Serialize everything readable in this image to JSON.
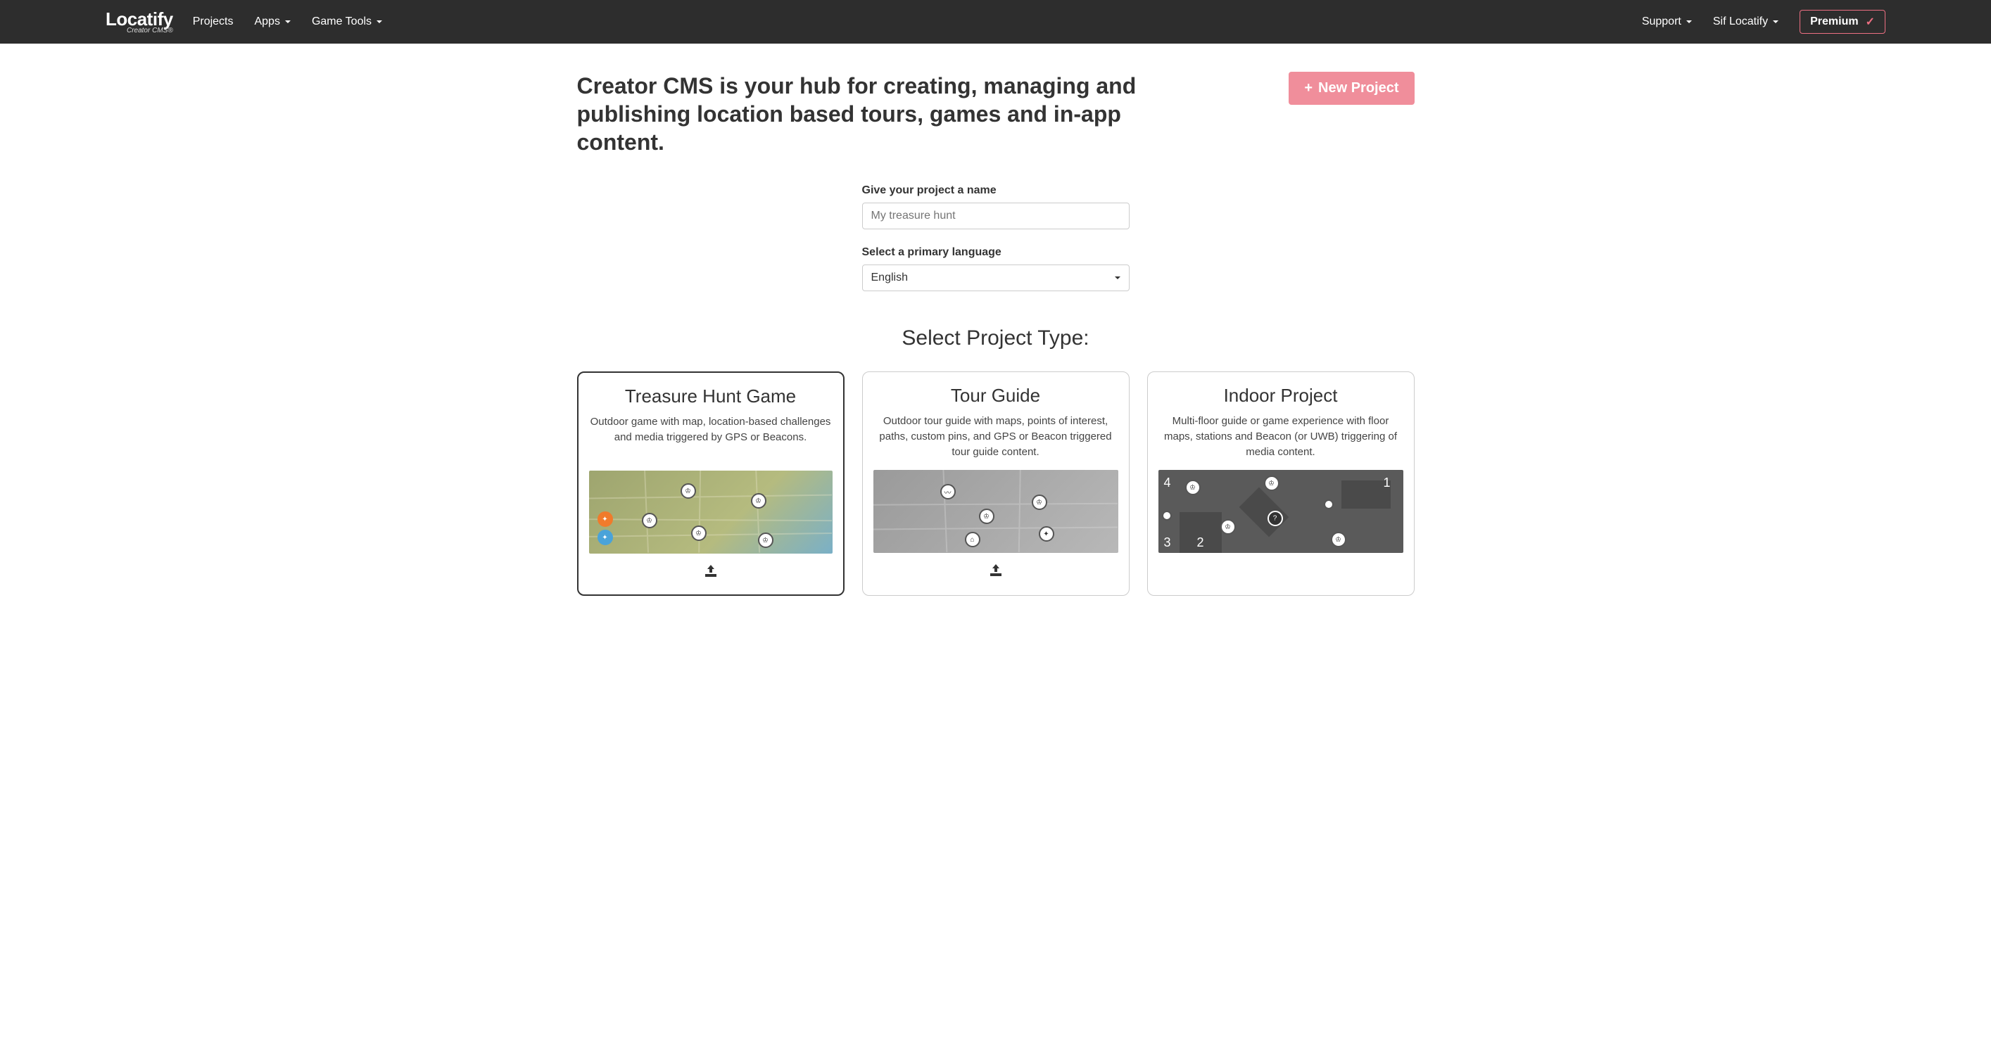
{
  "nav": {
    "brand": "Locatify",
    "brand_sub": "Creator CMS®",
    "items": [
      "Projects",
      "Apps",
      "Game Tools"
    ],
    "support": "Support",
    "user": "Sif Locatify",
    "premium": "Premium"
  },
  "hero": {
    "title": "Creator CMS is your hub for creating, managing and publishing location based tours, games and in-app content.",
    "new_project": "New Project"
  },
  "form": {
    "name_label": "Give your project a name",
    "name_placeholder": "My treasure hunt",
    "lang_label": "Select a primary language",
    "lang_value": "English"
  },
  "types": {
    "title": "Select Project Type:",
    "cards": [
      {
        "title": "Treasure Hunt Game",
        "desc": "Outdoor game with map, location-based challenges and media triggered by GPS or Beacons."
      },
      {
        "title": "Tour Guide",
        "desc": "Outdoor tour guide with maps, points of interest, paths, custom pins, and GPS or Beacon triggered tour guide content."
      },
      {
        "title": "Indoor Project",
        "desc": "Multi-floor guide or game experience with floor maps, stations and Beacon (or UWB) triggering of media content."
      }
    ]
  }
}
